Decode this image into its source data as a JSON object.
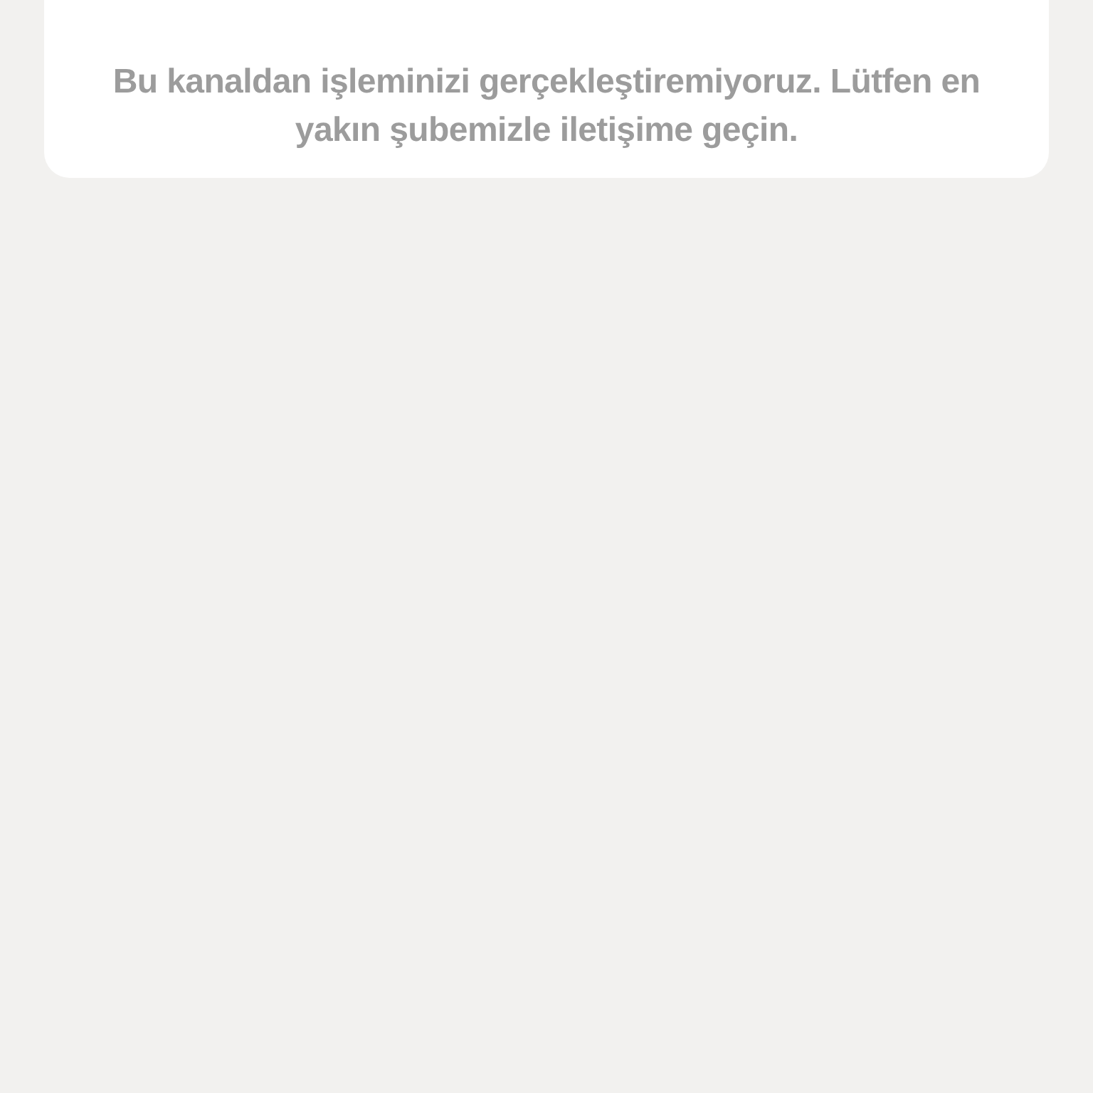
{
  "message": "Bu kanaldan işleminizi gerçekleştiremiyoruz. Lütfen en yakın şubemizle iletişime geçin."
}
